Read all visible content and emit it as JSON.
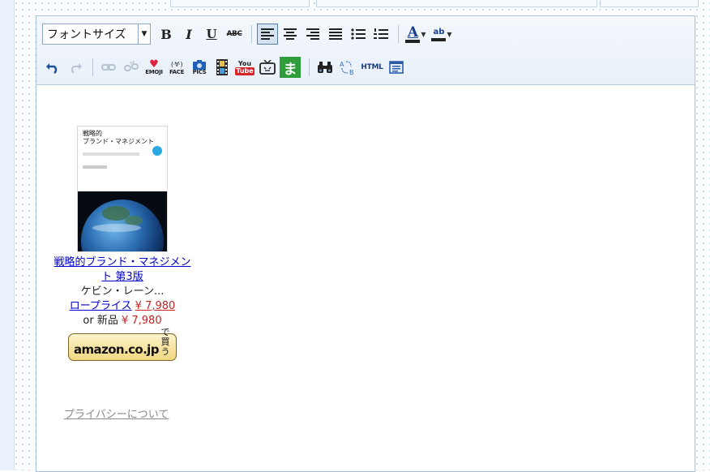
{
  "toolbar": {
    "font_size_label": "フォントサイズ",
    "bold": "B",
    "italic": "I",
    "underline": "U",
    "strike": "ABC",
    "font_color": "A",
    "highlight": "ab",
    "emoji": "EMOJI",
    "face": "FACE",
    "face_glyph": "(·∀·)",
    "pics": "PICS",
    "youtube_top": "You",
    "youtube_bottom": "Tube",
    "ma": "ま",
    "html": "HTML"
  },
  "product": {
    "cover_title_line1": "戦略的",
    "cover_title_line2": "ブランド・マネジメント",
    "title_line1": "戦略的ブランド・マネジメン",
    "title_line2": "ト 第3版",
    "author": "ケビン・レーン...",
    "low_price_label": "ロープライス",
    "low_price": "¥ 7,980",
    "new_label": "or 新品",
    "new_price": "¥ 7,980",
    "buy_logo": "amazon.co.jp",
    "buy_label": "で買う"
  },
  "privacy_link": "プライバシーについて"
}
